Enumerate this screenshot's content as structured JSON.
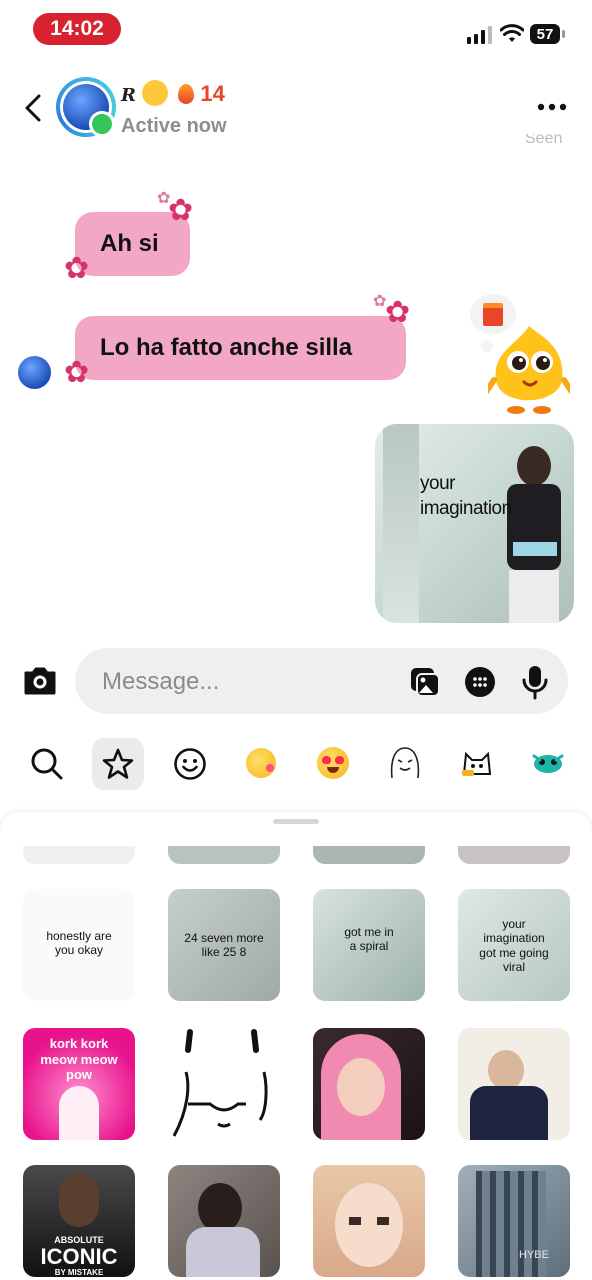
{
  "status_bar": {
    "time": "14:02",
    "battery": "57"
  },
  "header": {
    "name_prefix": "R",
    "streak": "14",
    "status": "Active now"
  },
  "messages": [
    {
      "text": "Ah si"
    },
    {
      "text": "Lo ha fatto anche silla"
    }
  ],
  "image_message": {
    "caption_1": "your",
    "caption_2": "imagination"
  },
  "seen_label": "Seen",
  "composer": {
    "placeholder": "Message..."
  },
  "sticker_tabs": [
    "search-icon",
    "star-icon",
    "smiley-icon",
    "emoji-kiss",
    "emoji-heart-eyes",
    "sticker-drawn-face",
    "sticker-cat",
    "sticker-crying"
  ],
  "stickers": {
    "row2": [
      {
        "lines": [
          "honestly are",
          "you okay"
        ]
      },
      {
        "lines": [
          "24 seven more",
          "like 25 8"
        ]
      },
      {
        "lines": [
          "got me in",
          "a spiral"
        ]
      },
      {
        "lines": [
          "your",
          "imagination",
          "got me going",
          "viral"
        ]
      }
    ],
    "row3": [
      {
        "lines": [
          "kork kork",
          "meow meow",
          "pow"
        ]
      },
      {
        "lines": []
      },
      {
        "lines": []
      },
      {
        "lines": []
      }
    ],
    "row4": [
      {
        "lines": [
          "ABSOLUTE",
          "ICONIC",
          "BY MISTAKE"
        ]
      },
      {
        "lines": []
      },
      {
        "lines": []
      },
      {
        "lines": [
          "HYBE"
        ]
      }
    ]
  },
  "colors": {
    "bubble": "#f2a7c4",
    "accent": "#d8222f",
    "online": "#33c759"
  }
}
